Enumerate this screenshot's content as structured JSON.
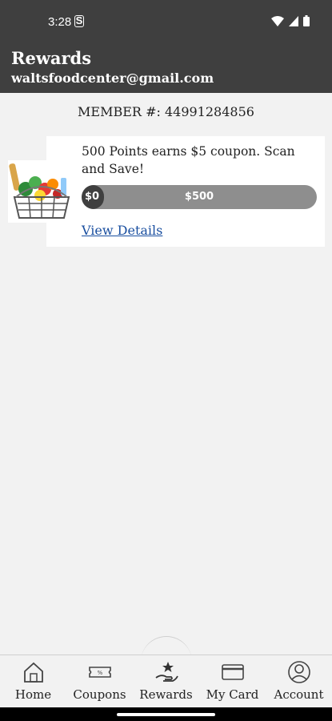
{
  "status_bar": {
    "time": "3:28",
    "s_icon": "S"
  },
  "header": {
    "title": "Rewards",
    "email": "waltsfoodcenter@gmail.com"
  },
  "member": {
    "label": "MEMBER #:",
    "number": "44991284856"
  },
  "reward": {
    "description": "500 Points earns $5 coupon. Scan and Save!",
    "progress_start": "$0",
    "progress_end": "$500",
    "progress_fraction": 0.0,
    "link": "View Details",
    "image_icon": "grocery-basket"
  },
  "nav": [
    {
      "label": "Home",
      "icon": "home-icon"
    },
    {
      "label": "Coupons",
      "icon": "coupon-icon"
    },
    {
      "label": "Rewards",
      "icon": "rewards-icon",
      "selected": true
    },
    {
      "label": "My Card",
      "icon": "card-icon"
    },
    {
      "label": "Account",
      "icon": "account-icon"
    }
  ],
  "colors": {
    "header": "#3f3f3f",
    "background": "#f2f2f2",
    "link": "#1a4fa0",
    "progress_track": "#8e8e8e"
  }
}
